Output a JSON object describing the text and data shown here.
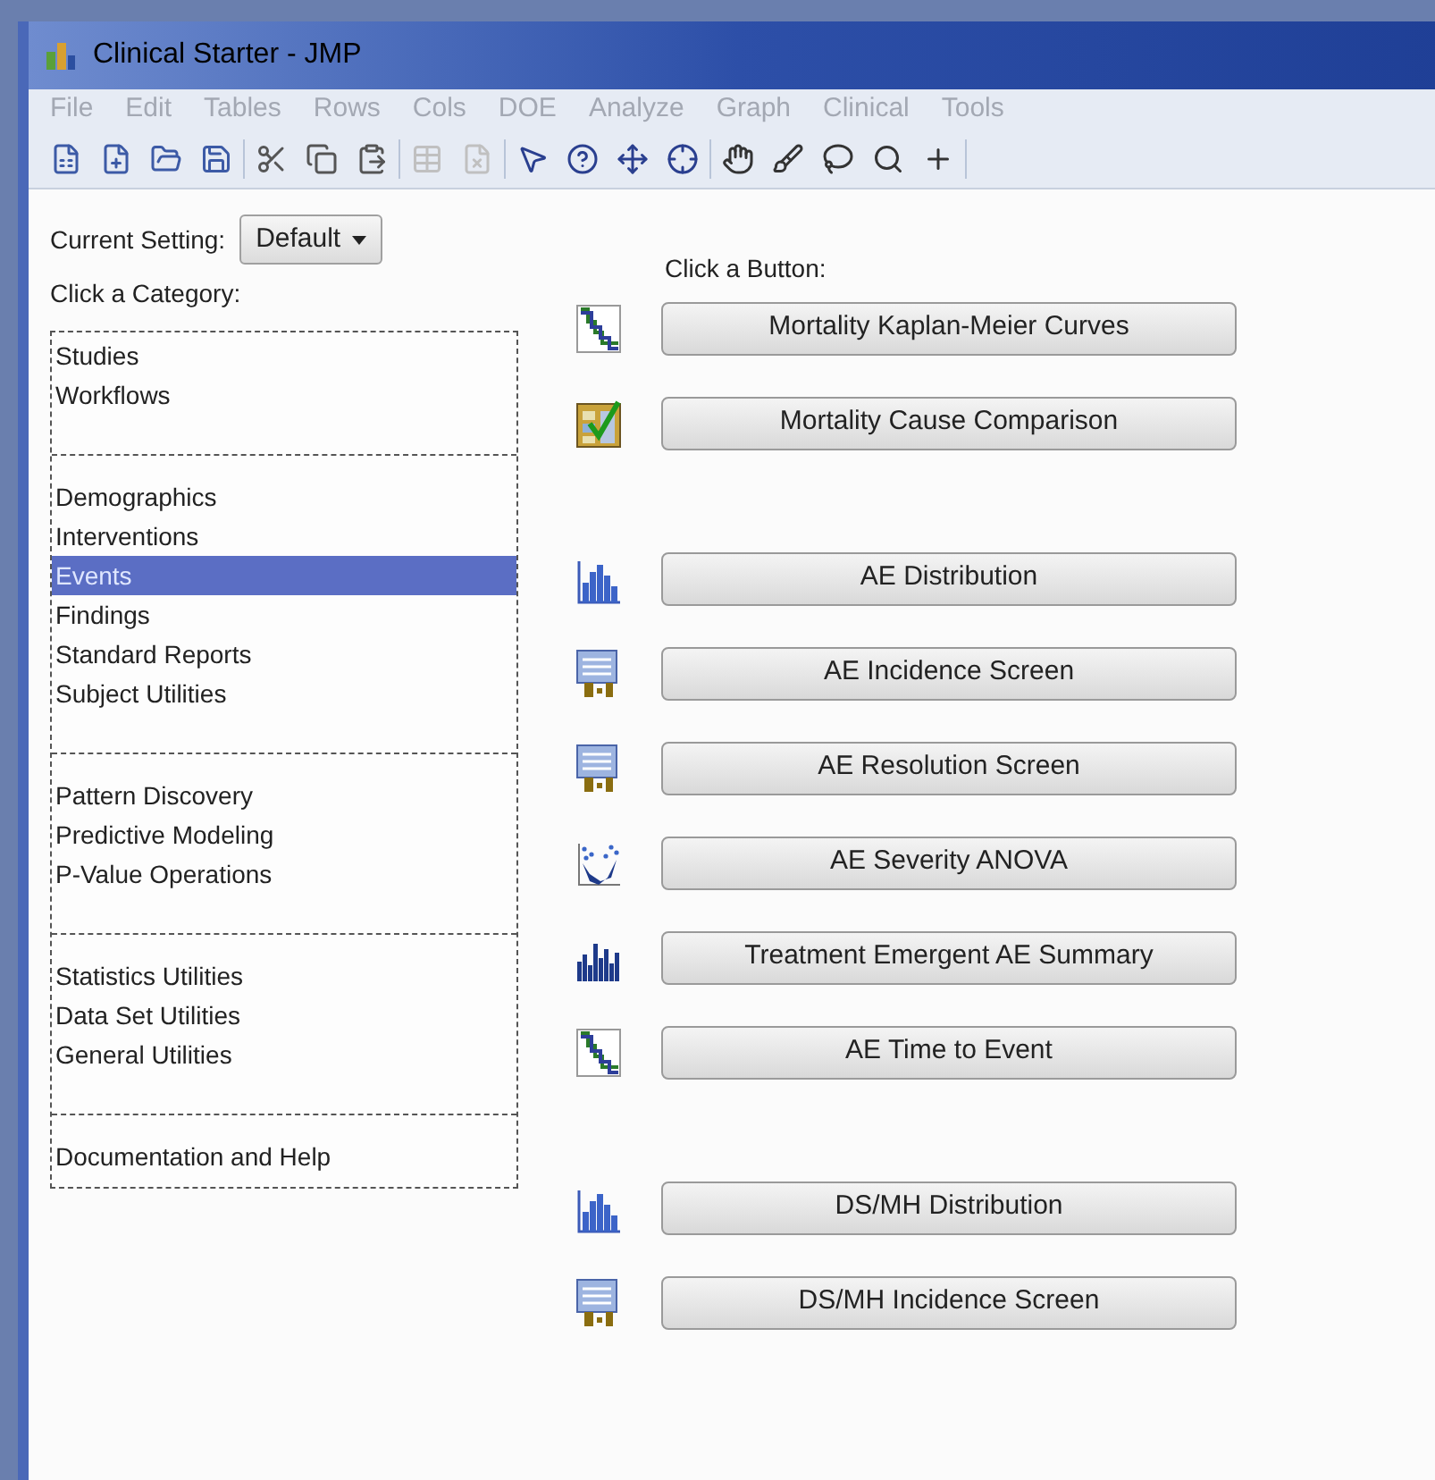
{
  "window": {
    "title": "Clinical Starter - JMP"
  },
  "menu": [
    "File",
    "Edit",
    "Tables",
    "Rows",
    "Cols",
    "DOE",
    "Analyze",
    "Graph",
    "Clinical",
    "Tools"
  ],
  "setting": {
    "label": "Current Setting:",
    "value": "Default"
  },
  "category_heading": "Click a Category:",
  "category_groups": [
    [
      {
        "label": "Studies",
        "selected": false
      },
      {
        "label": "Workflows",
        "selected": false
      }
    ],
    [
      {
        "label": "Demographics",
        "selected": false
      },
      {
        "label": "Interventions",
        "selected": false
      },
      {
        "label": "Events",
        "selected": true
      },
      {
        "label": "Findings",
        "selected": false
      },
      {
        "label": "Standard Reports",
        "selected": false
      },
      {
        "label": "Subject Utilities",
        "selected": false
      }
    ],
    [
      {
        "label": "Pattern Discovery",
        "selected": false
      },
      {
        "label": "Predictive Modeling",
        "selected": false
      },
      {
        "label": "P-Value Operations",
        "selected": false
      }
    ],
    [
      {
        "label": "Statistics Utilities",
        "selected": false
      },
      {
        "label": "Data Set Utilities",
        "selected": false
      },
      {
        "label": "General Utilities",
        "selected": false
      }
    ],
    [
      {
        "label": "Documentation and Help",
        "selected": false
      }
    ]
  ],
  "button_heading": "Click a Button:",
  "button_groups": [
    [
      {
        "label": "Mortality Kaplan-Meier Curves",
        "kind": "curve"
      },
      {
        "label": "Mortality Cause Comparison",
        "kind": "check"
      }
    ],
    [
      {
        "label": "AE Distribution",
        "kind": "histogram"
      },
      {
        "label": "AE Incidence Screen",
        "kind": "screen"
      },
      {
        "label": "AE Resolution Screen",
        "kind": "screen"
      },
      {
        "label": "AE Severity ANOVA",
        "kind": "scatter"
      },
      {
        "label": "Treatment Emergent AE Summary",
        "kind": "dense"
      },
      {
        "label": "AE Time to Event",
        "kind": "curve"
      }
    ],
    [
      {
        "label": "DS/MH Distribution",
        "kind": "histogram"
      },
      {
        "label": "DS/MH Incidence Screen",
        "kind": "screen"
      }
    ]
  ]
}
